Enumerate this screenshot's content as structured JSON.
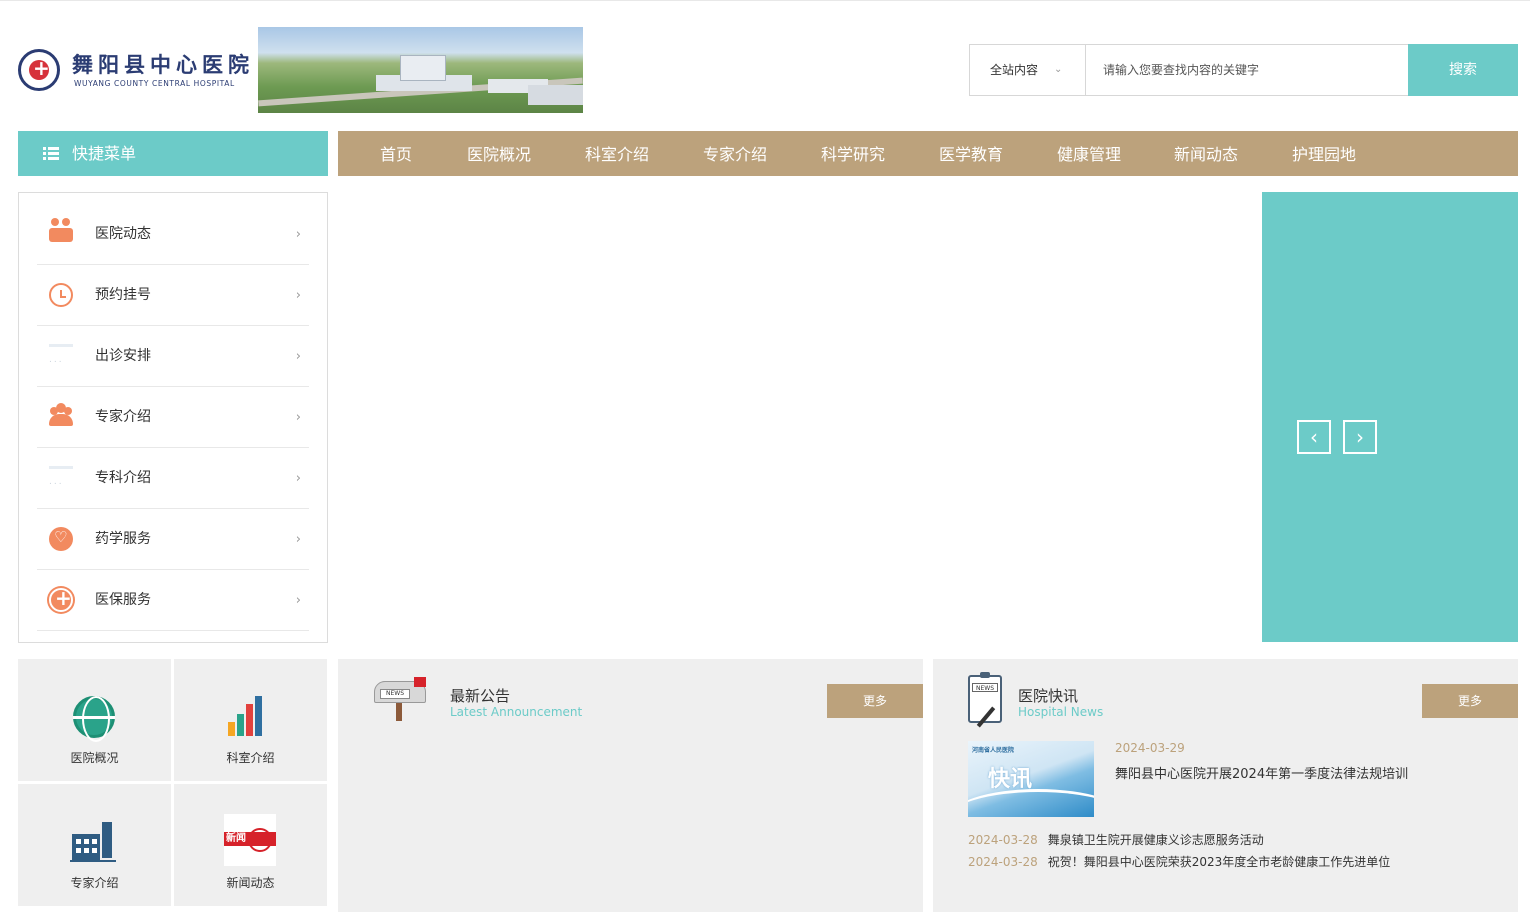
{
  "site": {
    "name": "舞阳县中心医院",
    "name_en": "WUYANG COUNTY CENTRAL HOSPITAL"
  },
  "search": {
    "scope": "全站内容",
    "placeholder": "请输入您要查找内容的关键字",
    "button": "搜索"
  },
  "quick_menu": {
    "title": "快捷菜单",
    "items": [
      {
        "label": "医院动态",
        "icon": "hospital-icon"
      },
      {
        "label": "预约挂号",
        "icon": "clock-icon"
      },
      {
        "label": "出诊安排",
        "icon": "schedule-icon"
      },
      {
        "label": "专家介绍",
        "icon": "doctors-icon"
      },
      {
        "label": "专科介绍",
        "icon": "department-icon"
      },
      {
        "label": "药学服务",
        "icon": "heart-icon"
      },
      {
        "label": "医保服务",
        "icon": "plus-icon"
      }
    ]
  },
  "nav": {
    "items": [
      "首页",
      "医院概况",
      "科室介绍",
      "专家介绍",
      "科学研究",
      "医学教育",
      "健康管理",
      "新闻动态",
      "护理园地"
    ]
  },
  "slider": {
    "prev": "‹",
    "next": "›"
  },
  "tiles": [
    {
      "label": "医院概况",
      "icon": "globe-icon"
    },
    {
      "label": "科室介绍",
      "icon": "bar-chart-icon"
    },
    {
      "label": "专家介绍",
      "icon": "building-icon"
    },
    {
      "label": "新闻动态",
      "icon": "news-icon"
    }
  ],
  "announcement": {
    "title": "最新公告",
    "subtitle": "Latest Announcement",
    "more": "更多",
    "icon_text": "NEWS"
  },
  "news": {
    "title": "医院快讯",
    "subtitle": "Hospital News",
    "more": "更多",
    "icon_text": "NEWS",
    "thumb_org": "河南省人民医院",
    "thumb_text": "快讯",
    "featured": {
      "date": "2024-03-29",
      "title": "舞阳县中心医院开展2024年第一季度法律法规培训"
    },
    "list": [
      {
        "date": "2024-03-28",
        "title": "舞泉镇卫生院开展健康义诊志愿服务活动"
      },
      {
        "date": "2024-03-28",
        "title": "祝贺！舞阳县中心医院荣获2023年度全市老龄健康工作先进单位"
      }
    ]
  },
  "colors": {
    "teal": "#6ccbc8",
    "gold": "#bca27c",
    "icon_orange": "#f28a5f",
    "panel_bg": "#efefef"
  }
}
